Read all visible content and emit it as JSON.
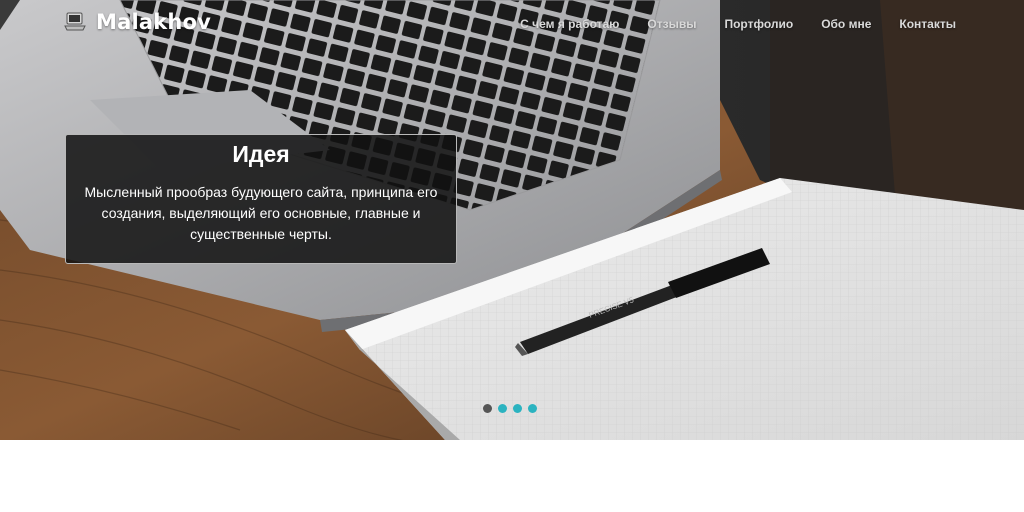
{
  "brand": {
    "name": "Malakhov",
    "icon": "laptop-logo-icon"
  },
  "nav": {
    "items": [
      {
        "label": "С чем я работаю"
      },
      {
        "label": "Отзывы"
      },
      {
        "label": "Портфолио"
      },
      {
        "label": "Обо мне"
      },
      {
        "label": "Контакты"
      }
    ]
  },
  "hero": {
    "caption": {
      "title": "Идея",
      "text": "Мысленный прообраз будующего сайта, принципа его создания, выделяющий его основные, главные и существенные черты."
    },
    "slides_count": 4,
    "active_slide": 1,
    "pen_label": "PRECISE V5"
  },
  "colors": {
    "indicator": "#2bb3c0",
    "indicator_active": "#555555",
    "caption_bg": "#121212"
  }
}
